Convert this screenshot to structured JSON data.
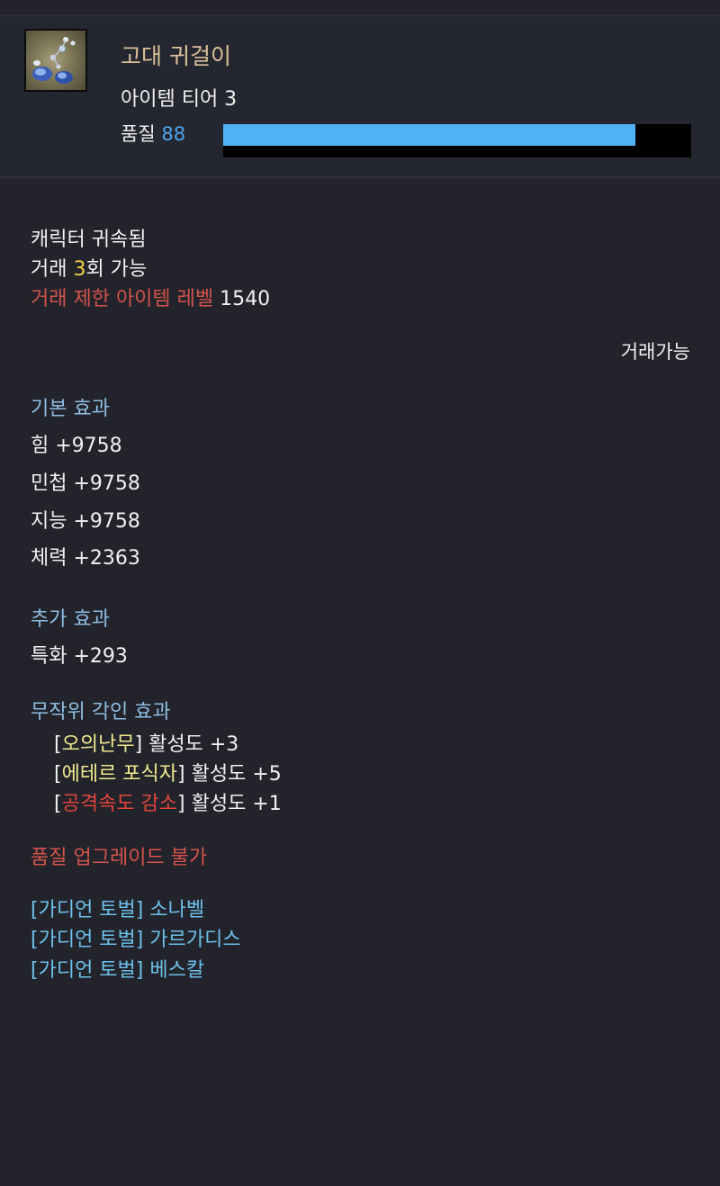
{
  "item": {
    "name": "고대 귀걸이",
    "tier_label": "아이템 티어 3",
    "quality_label": "품질",
    "quality_value": "88",
    "quality_fraction": 0.88,
    "icon": "earring-icon"
  },
  "trade": {
    "bound": "캐릭터 귀속됨",
    "trade_prefix": "거래 ",
    "trade_count": "3",
    "trade_suffix": "회 가능",
    "restrict_label": "거래 제한 아이템 레벨",
    "restrict_value": "1540",
    "tradeable": "거래가능"
  },
  "basic_effect": {
    "title": "기본 효과",
    "stats": [
      "힘 +9758",
      "민첩 +9758",
      "지능 +9758",
      "체력 +2363"
    ]
  },
  "extra_effect": {
    "title": "추가 효과",
    "stats": [
      "특화 +293"
    ]
  },
  "engravings": {
    "title": "무작위 각인 효과",
    "items": [
      {
        "open": "[",
        "name": "오의난무",
        "close": "]",
        "suffix": " 활성도 +3"
      },
      {
        "open": "[",
        "name": "에테르 포식자",
        "close": "]",
        "suffix": " 활성도 +5"
      },
      {
        "open": "[",
        "name": "공격속도 감소",
        "close": "]",
        "suffix": " 활성도 +1"
      }
    ]
  },
  "quality_upgrade": "품질 업그레이드 불가",
  "guardians": [
    "[가디언 토벌] 소나벨",
    "[가디언 토벌] 가르가디스",
    "[가디언 토벌] 베스칼"
  ],
  "colors": {
    "background": "#22232b",
    "item_name": "#d9bf9a",
    "quality_bar": "#50b3f5",
    "quality_value": "#4aa6ec",
    "section_title": "#8fbde0",
    "negative": "#d4534c",
    "engraving_positive": "#f0ea8e",
    "engraving_negative": "#e2453e",
    "guardian": "#6cc1ea"
  }
}
